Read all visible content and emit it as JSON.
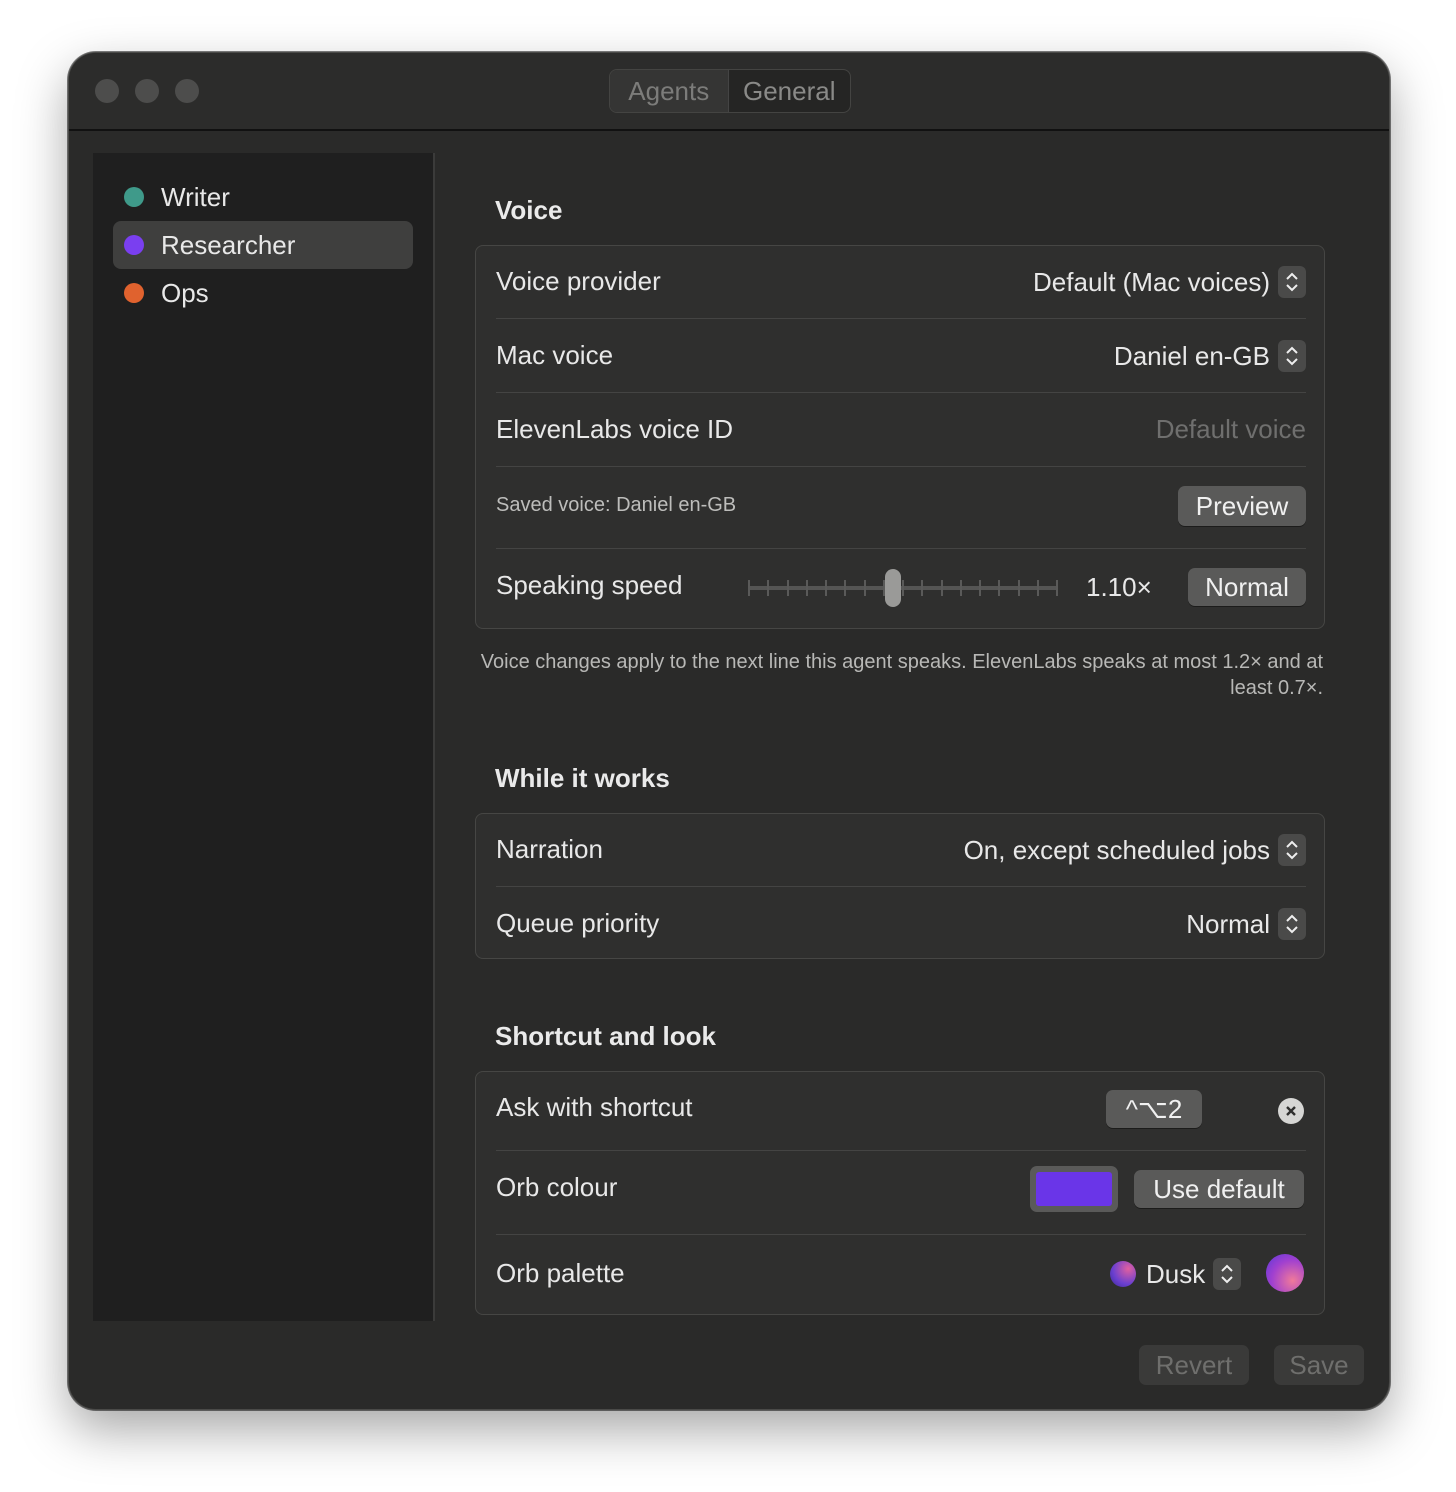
{
  "window": {
    "tabs": [
      {
        "label": "Agents",
        "selected": true
      },
      {
        "label": "General",
        "selected": false
      }
    ]
  },
  "sidebar": {
    "items": [
      {
        "label": "Writer",
        "color": "#3f9a8a",
        "selected": false
      },
      {
        "label": "Researcher",
        "color": "#7a3ff0",
        "selected": true
      },
      {
        "label": "Ops",
        "color": "#e0622e",
        "selected": false
      }
    ]
  },
  "voice": {
    "title": "Voice",
    "provider_label": "Voice provider",
    "provider_value": "Default (Mac voices)",
    "mac_voice_label": "Mac voice",
    "mac_voice_value": "Daniel en-GB",
    "elevenlabs_label": "ElevenLabs voice ID",
    "elevenlabs_placeholder": "Default voice",
    "saved_voice_text": "Saved voice: Daniel en-GB",
    "preview_label": "Preview",
    "speed_label": "Speaking speed",
    "speed_value": "1.10×",
    "speed_numeric": 1.1,
    "speed_min": 0.7,
    "speed_max": 1.2,
    "normal_label": "Normal",
    "note": "Voice changes apply to the next line this agent speaks. ElevenLabs speaks at most 1.2× and at least 0.7×."
  },
  "while_it_works": {
    "title": "While it works",
    "narration_label": "Narration",
    "narration_value": "On, except scheduled jobs",
    "queue_label": "Queue priority",
    "queue_value": "Normal"
  },
  "shortcut_look": {
    "title": "Shortcut and look",
    "shortcut_label": "Ask with shortcut",
    "shortcut_value": "^⌥2",
    "orb_colour_label": "Orb colour",
    "orb_colour": "#6a35e8",
    "use_default_label": "Use default",
    "orb_palette_label": "Orb palette",
    "orb_palette_value": "Dusk"
  },
  "footer": {
    "revert_label": "Revert",
    "save_label": "Save"
  }
}
